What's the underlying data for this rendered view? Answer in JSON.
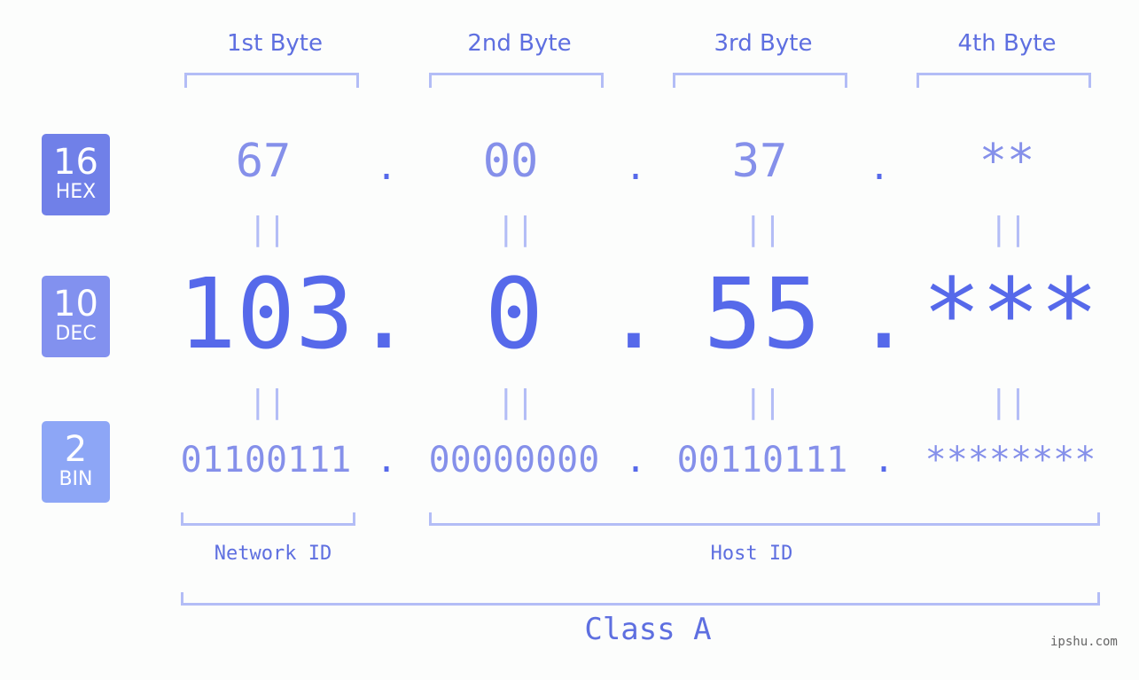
{
  "byte_headers": [
    "1st Byte",
    "2nd Byte",
    "3rd Byte",
    "4th Byte"
  ],
  "badges": [
    {
      "number": "16",
      "label": "HEX",
      "color": "#7080e8"
    },
    {
      "number": "10",
      "label": "DEC",
      "color": "#8291ef"
    },
    {
      "number": "2",
      "label": "BIN",
      "color": "#8da6f6"
    }
  ],
  "hex_values": [
    "67",
    "00",
    "37",
    "**"
  ],
  "dec_values": [
    "103",
    "0",
    "55",
    "***"
  ],
  "bin_values": [
    "01100111",
    "00000000",
    "00110111",
    "********"
  ],
  "separator": ".",
  "equals": "||",
  "network_label": "Network ID",
  "host_label": "Host ID",
  "class_label": "Class A",
  "watermark": "ipshu.com"
}
